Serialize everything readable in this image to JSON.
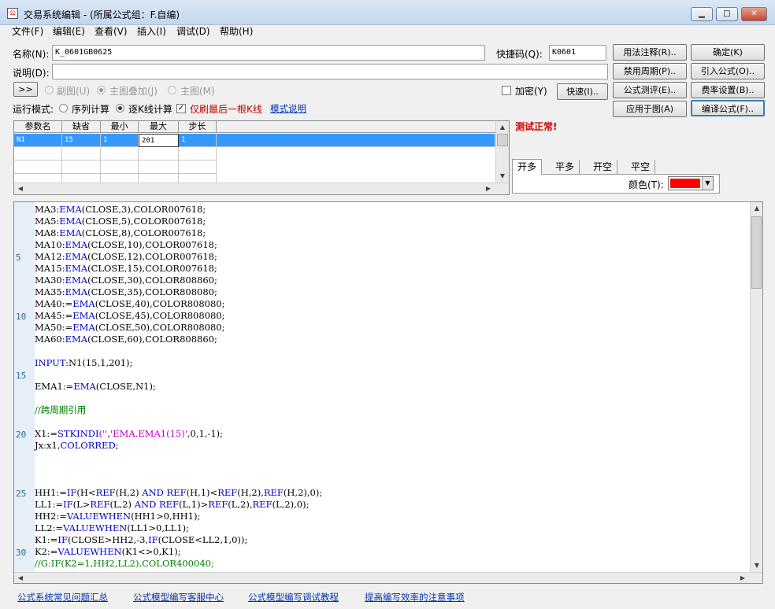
{
  "window": {
    "title": "交易系统编辑 - (所属公式组：F.自编)",
    "min_glyph": "▁",
    "max_glyph": "□",
    "close_glyph": "✕",
    "app_icon_glyph": "公"
  },
  "menu": [
    "文件(F)",
    "编辑(E)",
    "查看(V)",
    "插入(I)",
    "调试(D)",
    "帮助(H)"
  ],
  "form": {
    "name_label": "名称(N):",
    "name_value": "K_0601GB0625",
    "shortcut_label": "快捷码(Q):",
    "shortcut_value": "K0601",
    "desc_label": "说明(D):",
    "desc_value": "",
    "expand_glyph": ">>",
    "overlay_options": [
      "副图(U)",
      "主图叠加(J)",
      "主图(M)"
    ],
    "encrypt_label": "加密(Y)",
    "speed_button": "快速(I)..",
    "run_mode_label": "运行模式:",
    "run_mode_options": [
      "序列计算",
      "逐K线计算"
    ],
    "refresh_last_label": "仅刷最后一根K线",
    "mode_help_link": "模式说明"
  },
  "buttons": {
    "usage_notes": "用法注释(R)..",
    "confirm": "确定(K)",
    "disable_period": "禁用周期(P)..",
    "import_formula": "引入公式(O)..",
    "formula_eval": "公式测评(E)..",
    "fee_settings": "费率设置(B)..",
    "apply_to_chart": "应用于图(A)",
    "compile_formula": "编译公式(F).."
  },
  "params_table": {
    "headers": [
      "参数名",
      "缺省",
      "最小",
      "最大",
      "步长"
    ],
    "rows": [
      [
        "N1",
        "15",
        "1",
        "201",
        "1"
      ]
    ]
  },
  "status": {
    "message": "测试正常!",
    "message_color": "#d00000"
  },
  "signal_tabs": [
    "开多",
    "平多",
    "开空",
    "平空"
  ],
  "color_picker": {
    "label": "颜色(T):",
    "value": "#ff0000",
    "arrow_glyph": "▼"
  },
  "code_lines": [
    {
      "ln": "",
      "segs": [
        {
          "t": "MA3:"
        },
        {
          "t": "EMA",
          "c": "kw"
        },
        {
          "t": "(CLOSE,3),COLOR007618;"
        }
      ]
    },
    {
      "ln": "",
      "segs": [
        {
          "t": "MA5:"
        },
        {
          "t": "EMA",
          "c": "kw"
        },
        {
          "t": "(CLOSE,5),COLOR007618;"
        }
      ]
    },
    {
      "ln": "",
      "segs": [
        {
          "t": "MA8:"
        },
        {
          "t": "EMA",
          "c": "kw"
        },
        {
          "t": "(CLOSE,8),COLOR007618;"
        }
      ]
    },
    {
      "ln": "",
      "segs": [
        {
          "t": "MA10:"
        },
        {
          "t": "EMA",
          "c": "kw"
        },
        {
          "t": "(CLOSE,10),COLOR007618;"
        }
      ]
    },
    {
      "ln": "5",
      "segs": [
        {
          "t": "MA12:"
        },
        {
          "t": "EMA",
          "c": "kw"
        },
        {
          "t": "(CLOSE,12),COLOR007618;"
        }
      ]
    },
    {
      "ln": "",
      "segs": [
        {
          "t": "MA15:"
        },
        {
          "t": "EMA",
          "c": "kw"
        },
        {
          "t": "(CLOSE,15),COLOR007618;"
        }
      ]
    },
    {
      "ln": "",
      "segs": [
        {
          "t": "MA30:"
        },
        {
          "t": "EMA",
          "c": "kw"
        },
        {
          "t": "(CLOSE,30),COLOR808860;"
        }
      ]
    },
    {
      "ln": "",
      "segs": [
        {
          "t": "MA35:"
        },
        {
          "t": "EMA",
          "c": "kw"
        },
        {
          "t": "(CLOSE,35),COLOR808080;"
        }
      ]
    },
    {
      "ln": "",
      "segs": [
        {
          "t": "MA40:="
        },
        {
          "t": "EMA",
          "c": "kw"
        },
        {
          "t": "(CLOSE,40),COLOR808080;"
        }
      ]
    },
    {
      "ln": "10",
      "segs": [
        {
          "t": "MA45:="
        },
        {
          "t": "EMA",
          "c": "kw"
        },
        {
          "t": "(CLOSE,45),COLOR808080;"
        }
      ]
    },
    {
      "ln": "",
      "segs": [
        {
          "t": "MA50:="
        },
        {
          "t": "EMA",
          "c": "kw"
        },
        {
          "t": "(CLOSE,50),COLOR808080;"
        }
      ]
    },
    {
      "ln": "",
      "segs": [
        {
          "t": "MA60:"
        },
        {
          "t": "EMA",
          "c": "kw"
        },
        {
          "t": "(CLOSE,60),COLOR808860;"
        }
      ]
    },
    {
      "ln": "",
      "segs": [
        {
          "t": ""
        }
      ]
    },
    {
      "ln": "",
      "segs": [
        {
          "t": "INPUT",
          "c": "kw"
        },
        {
          "t": ":N1(15,1,201);"
        }
      ]
    },
    {
      "ln": "15",
      "segs": [
        {
          "t": ""
        }
      ]
    },
    {
      "ln": "",
      "segs": [
        {
          "t": "EMA1:="
        },
        {
          "t": "EMA",
          "c": "kw"
        },
        {
          "t": "(CLOSE,N1);"
        }
      ]
    },
    {
      "ln": "",
      "segs": [
        {
          "t": ""
        }
      ]
    },
    {
      "ln": "",
      "segs": [
        {
          "t": "//跨周期引用",
          "c": "cmt"
        }
      ]
    },
    {
      "ln": "",
      "segs": [
        {
          "t": ""
        }
      ]
    },
    {
      "ln": "20",
      "segs": [
        {
          "t": "X1:="
        },
        {
          "t": "STKINDI",
          "c": "kw"
        },
        {
          "t": "(''",
          "c": "str"
        },
        {
          "t": ","
        },
        {
          "t": "'EMA.EMA1(15)'",
          "c": "str"
        },
        {
          "t": ",0,1,-1);"
        }
      ]
    },
    {
      "ln": "",
      "segs": [
        {
          "t": "Jx:x1,"
        },
        {
          "t": "COLORRED",
          "c": "kw"
        },
        {
          "t": ";"
        }
      ]
    },
    {
      "ln": "",
      "segs": [
        {
          "t": ""
        }
      ]
    },
    {
      "ln": "",
      "segs": [
        {
          "t": ""
        }
      ]
    },
    {
      "ln": "",
      "segs": [
        {
          "t": ""
        }
      ]
    },
    {
      "ln": "25",
      "segs": [
        {
          "t": "HH1:="
        },
        {
          "t": "IF",
          "c": "kw"
        },
        {
          "t": "(H<"
        },
        {
          "t": "REF",
          "c": "kw"
        },
        {
          "t": "(H,2) "
        },
        {
          "t": "AND",
          "c": "kw"
        },
        {
          "t": " "
        },
        {
          "t": "REF",
          "c": "kw"
        },
        {
          "t": "(H,1)<"
        },
        {
          "t": "REF",
          "c": "kw"
        },
        {
          "t": "(H,2),"
        },
        {
          "t": "REF",
          "c": "kw"
        },
        {
          "t": "(H,2),0);"
        }
      ]
    },
    {
      "ln": "",
      "segs": [
        {
          "t": "LL1:="
        },
        {
          "t": "IF",
          "c": "kw"
        },
        {
          "t": "(L>"
        },
        {
          "t": "REF",
          "c": "kw"
        },
        {
          "t": "(L,2) "
        },
        {
          "t": "AND",
          "c": "kw"
        },
        {
          "t": " "
        },
        {
          "t": "REF",
          "c": "kw"
        },
        {
          "t": "(L,1)>"
        },
        {
          "t": "REF",
          "c": "kw"
        },
        {
          "t": "(L,2),"
        },
        {
          "t": "REF",
          "c": "kw"
        },
        {
          "t": "(L,2),0);"
        }
      ]
    },
    {
      "ln": "",
      "segs": [
        {
          "t": "HH2:="
        },
        {
          "t": "VALUEWHEN",
          "c": "kw"
        },
        {
          "t": "(HH1>0,HH1);"
        }
      ]
    },
    {
      "ln": "",
      "segs": [
        {
          "t": "LL2:="
        },
        {
          "t": "VALUEWHEN",
          "c": "kw"
        },
        {
          "t": "(LL1>0,LL1);"
        }
      ]
    },
    {
      "ln": "",
      "segs": [
        {
          "t": "K1:="
        },
        {
          "t": "IF",
          "c": "kw"
        },
        {
          "t": "(CLOSE>HH2,-3,"
        },
        {
          "t": "IF",
          "c": "kw"
        },
        {
          "t": "(CLOSE<LL2,1,0));"
        }
      ]
    },
    {
      "ln": "30",
      "segs": [
        {
          "t": "K2:="
        },
        {
          "t": "VALUEWHEN",
          "c": "kw"
        },
        {
          "t": "(K1<>0,K1);"
        }
      ]
    },
    {
      "ln": "",
      "segs": [
        {
          "t": "//G:IF(K2=1,HH2,LL2),COLOR400040;",
          "c": "cmt"
        }
      ]
    }
  ],
  "footer_links": [
    "公式系统常见问题汇总",
    "公式模型编写客服中心",
    "公式模型编写调试教程",
    "提高编写效率的注意事项"
  ]
}
